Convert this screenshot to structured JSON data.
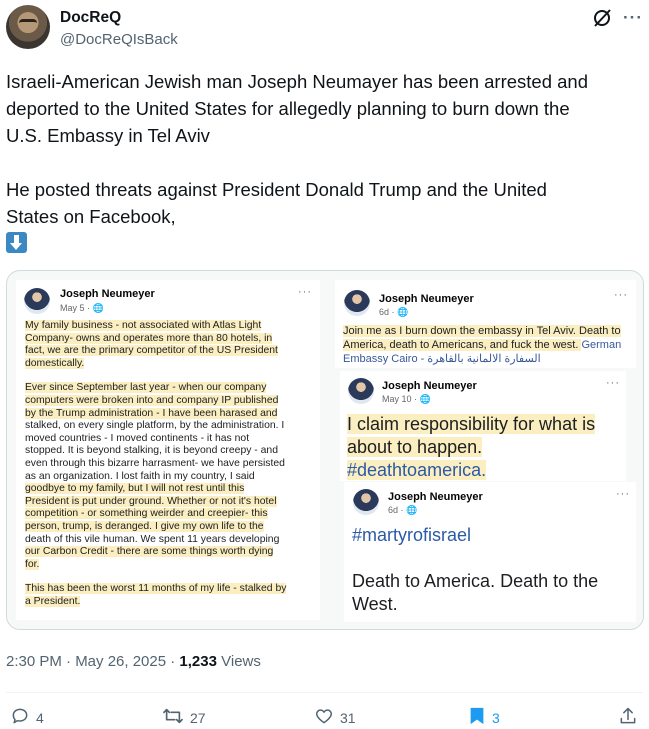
{
  "author": {
    "name": "DocReQ",
    "handle": "@DocReQIsBack"
  },
  "header_icons": [
    "grok-slash-icon",
    "more-dots-icon"
  ],
  "header_more": "···",
  "tweet": {
    "line1": "Israeli-American Jewish man Joseph Neumayer has been arrested and",
    "line2": "deported to the United States for allegedly planning to burn down the",
    "line3": "U.S. Embassy in Tel Aviv",
    "line4": "He posted threats against President Donald Trump and the United",
    "line5": "States on Facebook,"
  },
  "media": {
    "left_post": {
      "name": "Joseph Neumeyer",
      "date": "May 5 · ",
      "dots": "···",
      "lines": [
        "My family business - not associated with Atlas Light",
        "Company- owns and operates more than 80 hotels, in",
        "fact, we are the primary competitor of the US President",
        "domestically.",
        "Ever since September last year - when our company",
        "computers were broken into and company IP published",
        "by the Trump administration - I have been harased and",
        "stalked, on every single platform, by the administration. I",
        "moved countries - I moved continents - it has not",
        "stopped. It is beyond stalking, it is beyond creepy - and",
        "even through this bizarre harrasment- we have persisted",
        "as an organization. I lost faith in my country, I said",
        "goodbye to my family, but I will not rest until this",
        "President is put under ground. Whether or not it's hotel",
        "competition - or something weirder and creepier- this",
        "person, trump, is deranged. I give my own life to the",
        "death of this vile human. We spent 11 years developing",
        "our Carbon Credit - there are some things worth dying",
        "for.",
        "This has been the worst 11 months of my life - stalked by",
        "a President."
      ]
    },
    "right_post_1": {
      "name": "Joseph Neumeyer",
      "date": "6d · ",
      "dots": "···",
      "line1": "Join me as I burn down the embassy in Tel Aviv. Death to",
      "line2": "America, death to Americans, and fuck the west. ",
      "link1": "German",
      "link2": "Embassy Cairo - السفارة الالمانية بالقاهرة"
    },
    "right_post_2": {
      "name": "Joseph Neumeyer",
      "date": "May 10 · ",
      "dots": "···",
      "line1": "I claim responsibility for what is",
      "line2": "about to happen.",
      "hashtag": "#deathtoamerica."
    },
    "right_post_3": {
      "name": "Joseph Neumeyer",
      "date": "6d · ",
      "dots": "···",
      "hashtag": "#martyrofisrael",
      "line1": "Death to America. Death to the",
      "line2": "West."
    }
  },
  "meta": {
    "time": "2:30 PM · May 26, 2025 · ",
    "views_count": "1,233",
    "views_label": " Views"
  },
  "actions": {
    "replies": "4",
    "reposts": "27",
    "likes": "31",
    "bookmarks": "3"
  },
  "colors": {
    "accent": "#1d9bf0",
    "secondary_text": "#536471",
    "highlight": "#fbeec0"
  }
}
